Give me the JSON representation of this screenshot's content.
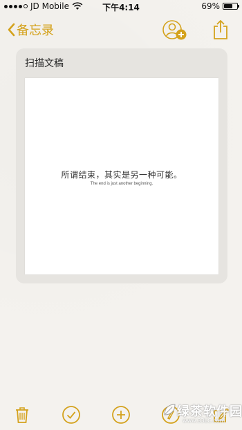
{
  "status_bar": {
    "carrier": "JD Mobile",
    "time": "下午4:14",
    "battery": "69%",
    "battery_level": 0.69
  },
  "nav": {
    "back_label": "备忘录"
  },
  "scan": {
    "title": "扫描文稿",
    "quote_cn": "所谓结束，其实是另一种可能。",
    "quote_en": "The end is just another beginning."
  },
  "watermark": {
    "text": "绿茶软件园",
    "url": "www.33LC.com"
  },
  "colors": {
    "accent": "#d4a21c"
  },
  "toolbar": {
    "icons": [
      "trash-icon",
      "checklist-icon",
      "add-icon",
      "markup-icon",
      "compose-icon"
    ]
  }
}
